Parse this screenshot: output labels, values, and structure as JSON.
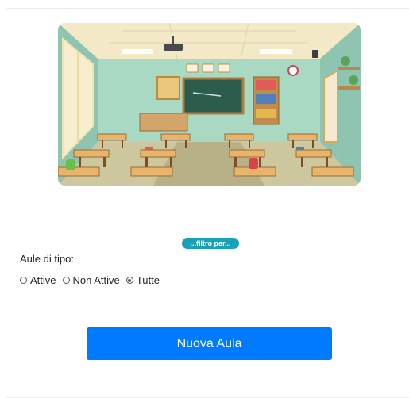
{
  "filter": {
    "badge_label": "...filtro per...",
    "title": "Aule di tipo:",
    "options": [
      {
        "label": "Attive",
        "checked": false
      },
      {
        "label": "Non Attive",
        "checked": false
      },
      {
        "label": "Tutte",
        "checked": true
      }
    ]
  },
  "actions": {
    "new_button_label": "Nuova Aula"
  },
  "colors": {
    "badge": "#17a2b8",
    "primary_button": "#007bff"
  }
}
